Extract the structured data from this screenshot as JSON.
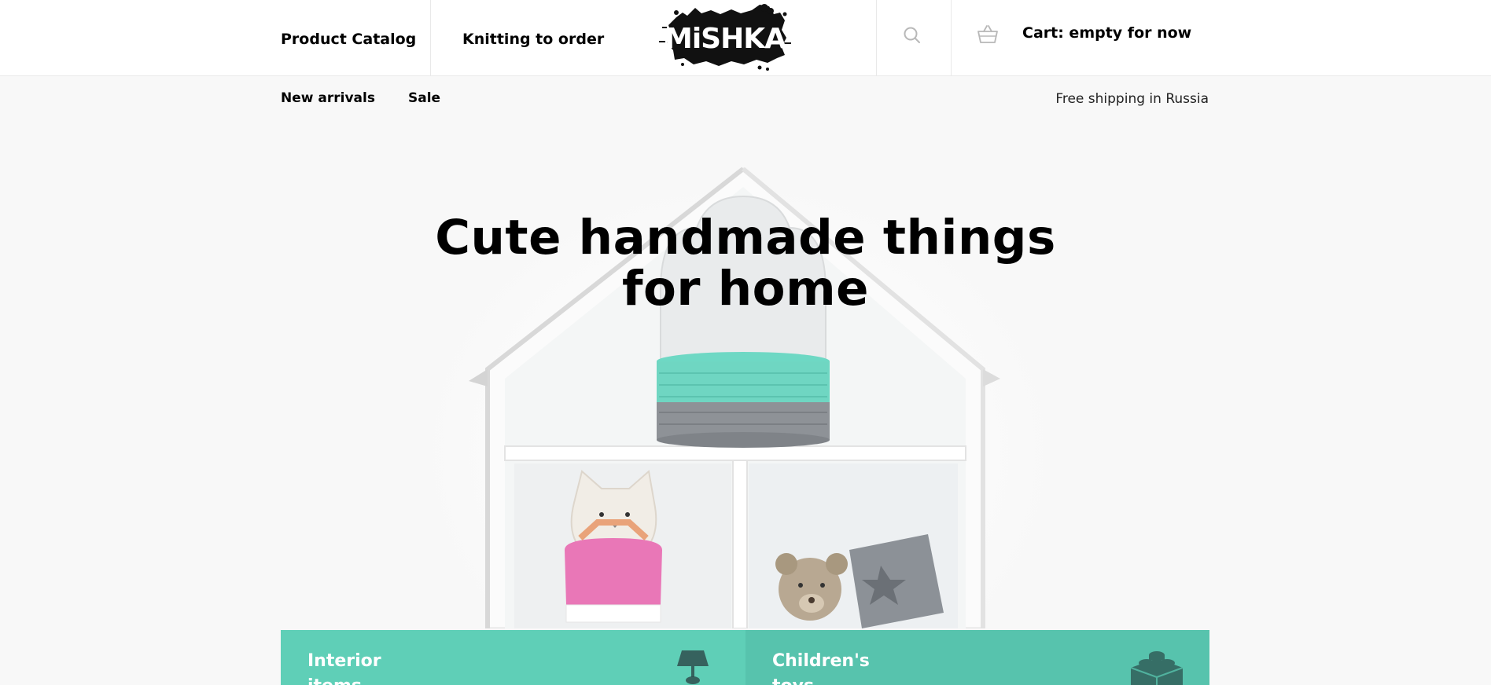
{
  "header": {
    "nav": [
      {
        "label": "Product Catalog"
      },
      {
        "label": "Knitting to order"
      }
    ],
    "logo_text": "MiSHKA",
    "cart_label": "Cart: empty for now"
  },
  "subnav": {
    "items": [
      {
        "label": "New arrivals"
      },
      {
        "label": "Sale"
      }
    ],
    "shipping_note": "Free shipping in Russia"
  },
  "hero": {
    "title_line1": "Cute handmade things",
    "title_line2": "for home"
  },
  "categories": [
    {
      "label": "Interior items",
      "icon": "lamp-icon",
      "color": "#5fcfb7"
    },
    {
      "label": "Children's toys",
      "icon": "toy-blocks-icon",
      "color": "#57c3ad"
    }
  ],
  "icons": {
    "search": "search-icon",
    "cart": "basket-icon"
  }
}
